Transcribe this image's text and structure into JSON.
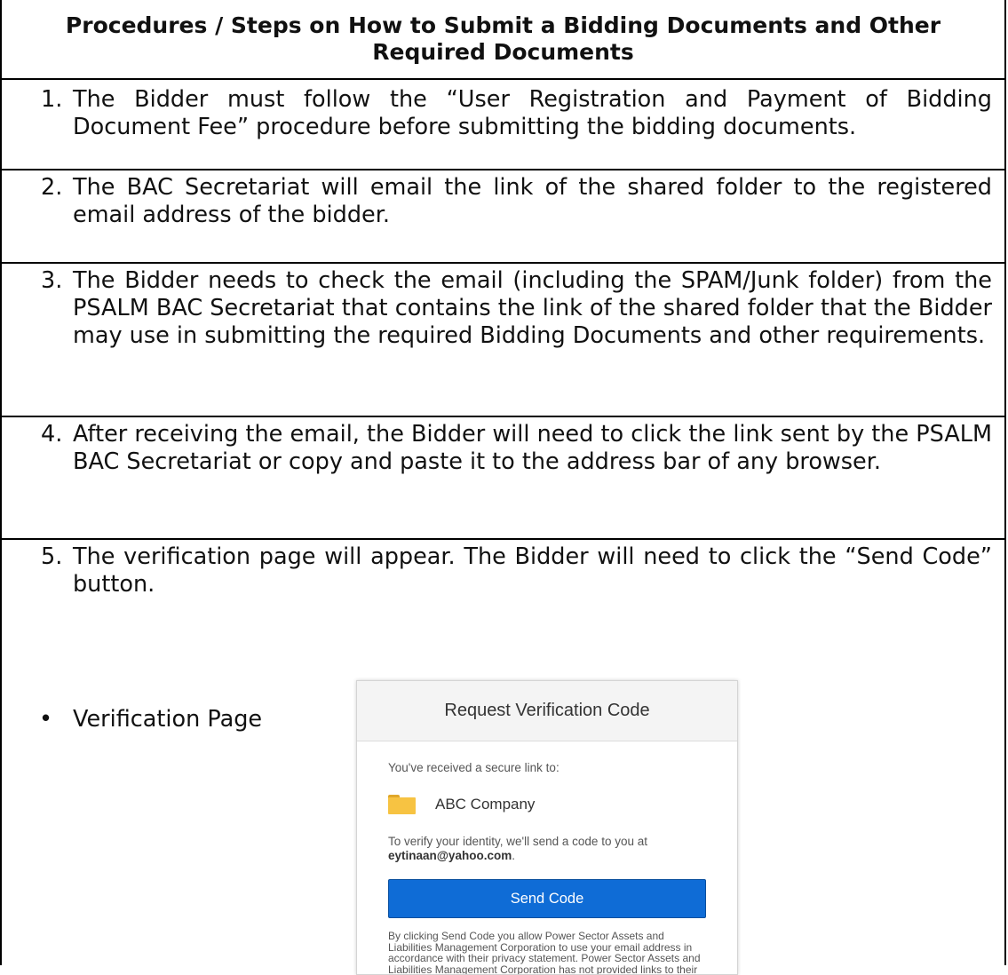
{
  "title": "Procedures / Steps on How to Submit a Bidding Documents and Other Required Documents",
  "steps": [
    {
      "num": "1.",
      "text": "The Bidder must follow the “User Registration and Payment of Bidding Document Fee” procedure before submitting the bidding documents."
    },
    {
      "num": "2.",
      "text": "The BAC Secretariat will email the link of the shared folder to the registered email address of the bidder."
    },
    {
      "num": "3.",
      "text": "The Bidder needs to check the email (including the SPAM/Junk folder) from the PSALM BAC Secretariat that contains the link of the shared folder that the Bidder may use in submitting the required Bidding Documents and other requirements."
    },
    {
      "num": "4.",
      "text": "After receiving the email, the Bidder will need to click the link sent by the PSALM BAC Secretariat or copy and paste it to the address bar of any browser."
    },
    {
      "num": "5.",
      "text": "The verification page will appear. The Bidder will need to click the “Send Code” button."
    }
  ],
  "bullet": {
    "symbol": "•",
    "text": "Verification Page"
  },
  "verification": {
    "heading": "Request Verification Code",
    "received_text": "You've received a secure link to:",
    "folder_icon": "folder-icon",
    "folder_name": "ABC Company",
    "verify_prefix": "To verify your identity, we'll send a code to you at ",
    "email": "eytinaan@yahoo.com",
    "verify_suffix": ".",
    "button_label": "Send Code",
    "button_color": "#0f6cd6",
    "disclaimer": "By clicking Send Code you allow Power Sector Assets and Liabilities Management Corporation to use your email address in accordance with their privacy statement. Power Sector Assets and Liabilities Management Corporation has not provided links to their terms for you to review."
  }
}
